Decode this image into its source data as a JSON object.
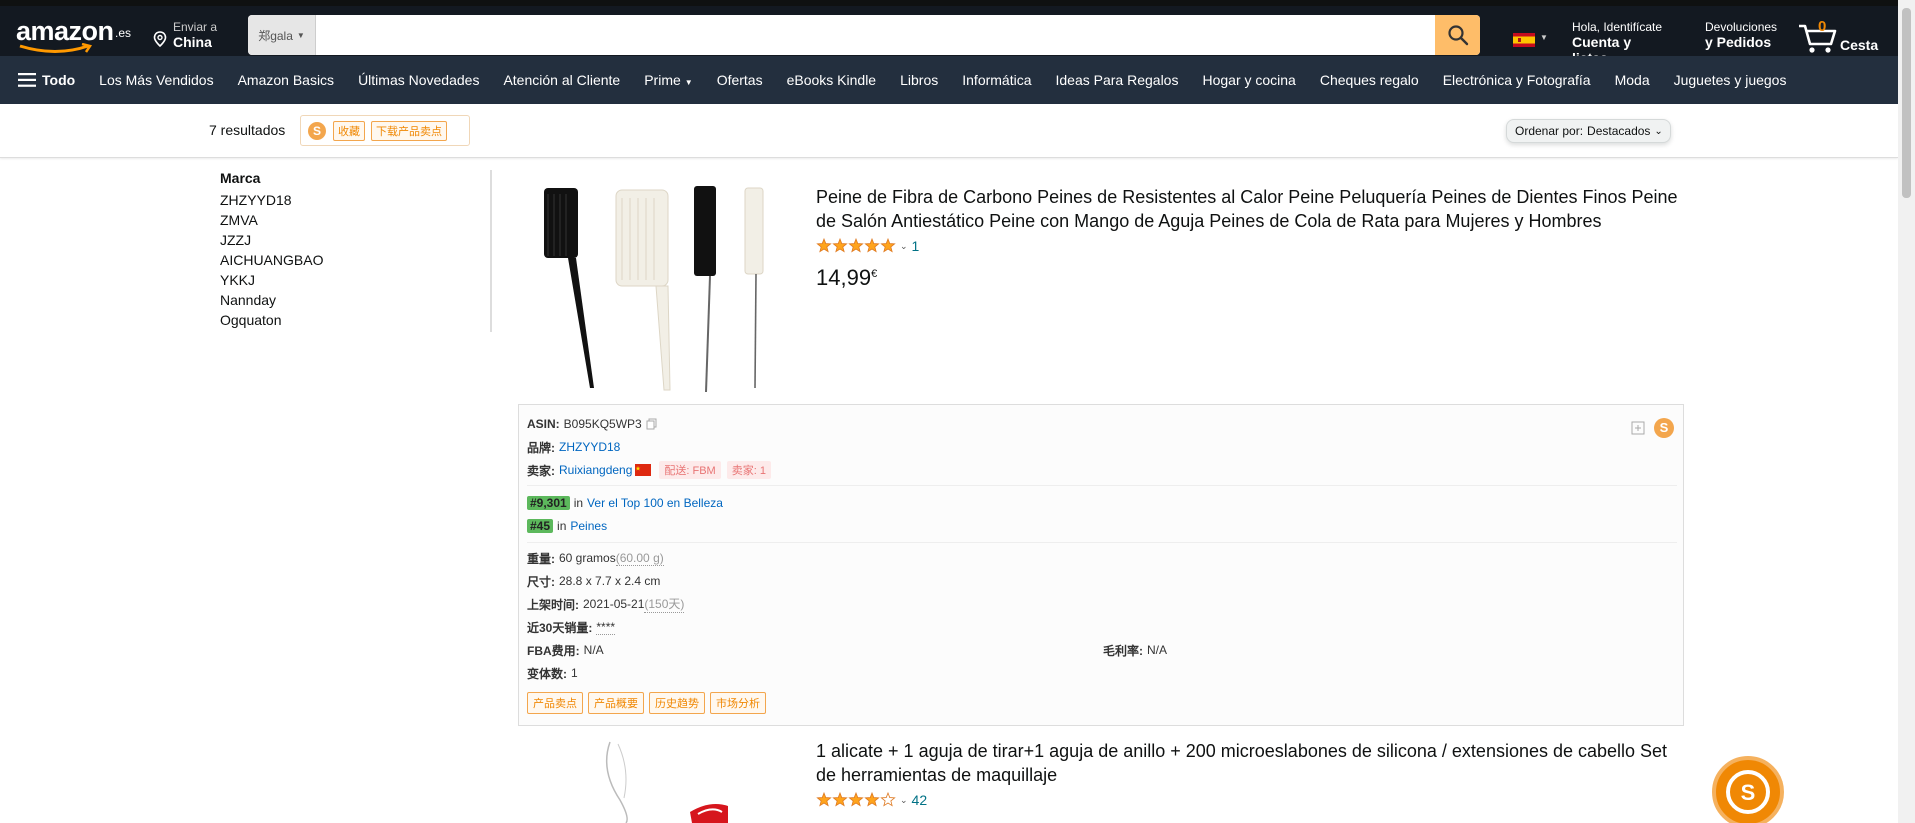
{
  "header": {
    "logo_text": "amazon",
    "logo_tld": ".es",
    "deliver_line1": "Enviar a",
    "deliver_line2": "China",
    "search_category": "郑gala",
    "search_value": "",
    "account_line1": "Hola, Identifícate",
    "account_line2": "Cuenta y listas",
    "returns_line1": "Devoluciones",
    "returns_line2": "y Pedidos",
    "cart_count": "0",
    "cart_label": "Cesta"
  },
  "subnav": {
    "all_label": "Todo",
    "items": [
      "Los Más Vendidos",
      "Amazon Basics",
      "Últimas Novedades",
      "Atención al Cliente",
      "Prime",
      "Ofertas",
      "eBooks Kindle",
      "Libros",
      "Informática",
      "Ideas Para Regalos",
      "Hogar y cocina",
      "Cheques regalo",
      "Electrónica y Fotografía",
      "Moda",
      "Juguetes y juegos"
    ]
  },
  "results": {
    "count_text": "7 resultados",
    "plugin_tag1": "收藏",
    "plugin_tag2": "下载产品卖点",
    "sort_label": "Ordenar por:",
    "sort_value": "Destacados"
  },
  "sidebar": {
    "heading": "Marca",
    "brands": [
      "ZHZYYD18",
      "ZMVA",
      "JZZJ",
      "AICHUANGBAO",
      "YKKJ",
      "Nannday",
      "Ogquaton"
    ]
  },
  "product1": {
    "title": "Peine de Fibra de Carbono Peines de Resistentes al Calor Peine Peluquería Peines de Dientes Finos Peine de Salón Antiestático Peine con Mango de Aguja Peines de Cola de Rata para Mujeres y Hombres",
    "rating": 5,
    "rating_count": "1",
    "price_whole": "14,99",
    "price_currency": "€"
  },
  "info": {
    "asin_label": "ASIN:",
    "asin_value": "B095KQ5WP3",
    "brand_label": "品牌:",
    "brand_value": "ZHZYYD18",
    "seller_label": "卖家:",
    "seller_value": "Ruixiangdeng",
    "ship_tag": "配送: FBM",
    "sellers_tag": "卖家: 1",
    "rank1_num": "#9,301",
    "rank1_in": "in",
    "rank1_cat": "Ver el Top 100 en Belleza",
    "rank2_num": "#45",
    "rank2_in": "in",
    "rank2_cat": "Peines",
    "weight_label": "重量:",
    "weight_value": "60 gramos",
    "weight_extra": "(60.00 g)",
    "size_label": "尺寸:",
    "size_value": "28.8 x 7.7 x 2.4 cm",
    "date_label": "上架时间:",
    "date_value": "2021-05-21",
    "date_extra": "(150天)",
    "sales_label": "近30天销量:",
    "sales_value": "****",
    "fba_label": "FBA费用:",
    "fba_value": "N/A",
    "margin_label": "毛利率:",
    "margin_value": "N/A",
    "variants_label": "变体数:",
    "variants_value": "1",
    "btn1": "产品卖点",
    "btn2": "产品概要",
    "btn3": "历史趋势",
    "btn4": "市场分析"
  },
  "product2": {
    "title": "1 alicate + 1 aguja de tirar+1 aguja de anillo + 200 microeslabones de silicona / extensiones de cabello Set de herramientas de maquillaje",
    "rating": 4,
    "rating_count": "42"
  },
  "colors": {
    "nav_bg": "#131921",
    "subnav_bg": "#232f3e",
    "search_button": "#febd69",
    "star": "#ffa41c",
    "link": "#007185",
    "plugin_orange": "#f08804"
  }
}
